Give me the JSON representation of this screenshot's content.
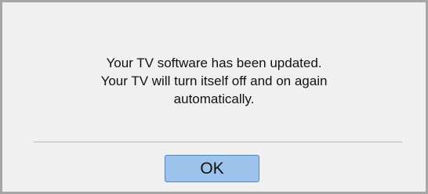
{
  "dialog": {
    "message_lines": [
      "Your TV software has been updated.",
      "Your TV will turn itself off and on again",
      "automatically."
    ],
    "ok_label": "OK"
  },
  "colors": {
    "dialog_background": "#f0f0f0",
    "dialog_border": "#a6a6a6",
    "button_fill": "#9dc3ec",
    "button_border": "#4f86c4",
    "divider": "#b8b8b8"
  }
}
